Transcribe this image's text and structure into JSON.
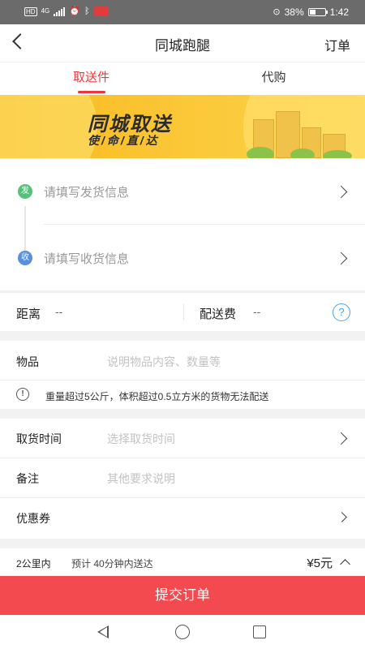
{
  "status_bar": {
    "network_badge": "HD",
    "network_type": "4G",
    "battery_percent": "38%",
    "time": "1:42",
    "icons": [
      "hd-icon",
      "4g-icon",
      "signal-icon",
      "alarm-icon",
      "bluetooth-icon",
      "app-notification-icon",
      "location-icon",
      "battery-icon"
    ]
  },
  "navbar": {
    "title": "同城跑腿",
    "right_link": "订单"
  },
  "tabs": [
    {
      "label": "取送件",
      "active": true
    },
    {
      "label": "代购",
      "active": false
    }
  ],
  "banner": {
    "title": "同城取送",
    "subtitle": "使/命/直/达"
  },
  "address": {
    "sender_badge": "发",
    "sender_placeholder": "请填写发货信息",
    "receiver_badge": "收",
    "receiver_placeholder": "请填写收货信息"
  },
  "distance": {
    "distance_label": "距离",
    "distance_value": "--",
    "fee_label": "配送费",
    "fee_value": "--",
    "help_glyph": "?"
  },
  "goods": {
    "label": "物品",
    "placeholder": "说明物品内容、数量等",
    "warning_glyph": "!",
    "warning": "重量超过5公斤，体积超过0.5立方米的货物无法配送"
  },
  "options": {
    "pickup_time_label": "取货时间",
    "pickup_time_placeholder": "选择取货时间",
    "remark_label": "备注",
    "remark_placeholder": "其他要求说明",
    "coupon_label": "优惠券"
  },
  "summary": {
    "range": "2公里内",
    "eta": "预计 40分钟内送达",
    "price": "¥5元"
  },
  "submit_label": "提交订单",
  "colors": {
    "accent": "#e8383d",
    "submit": "#f24a4f",
    "sender_badge": "#57c07b",
    "receiver_badge": "#5a8fe0",
    "banner": "#fbc93a",
    "help": "#4aa3e8"
  }
}
